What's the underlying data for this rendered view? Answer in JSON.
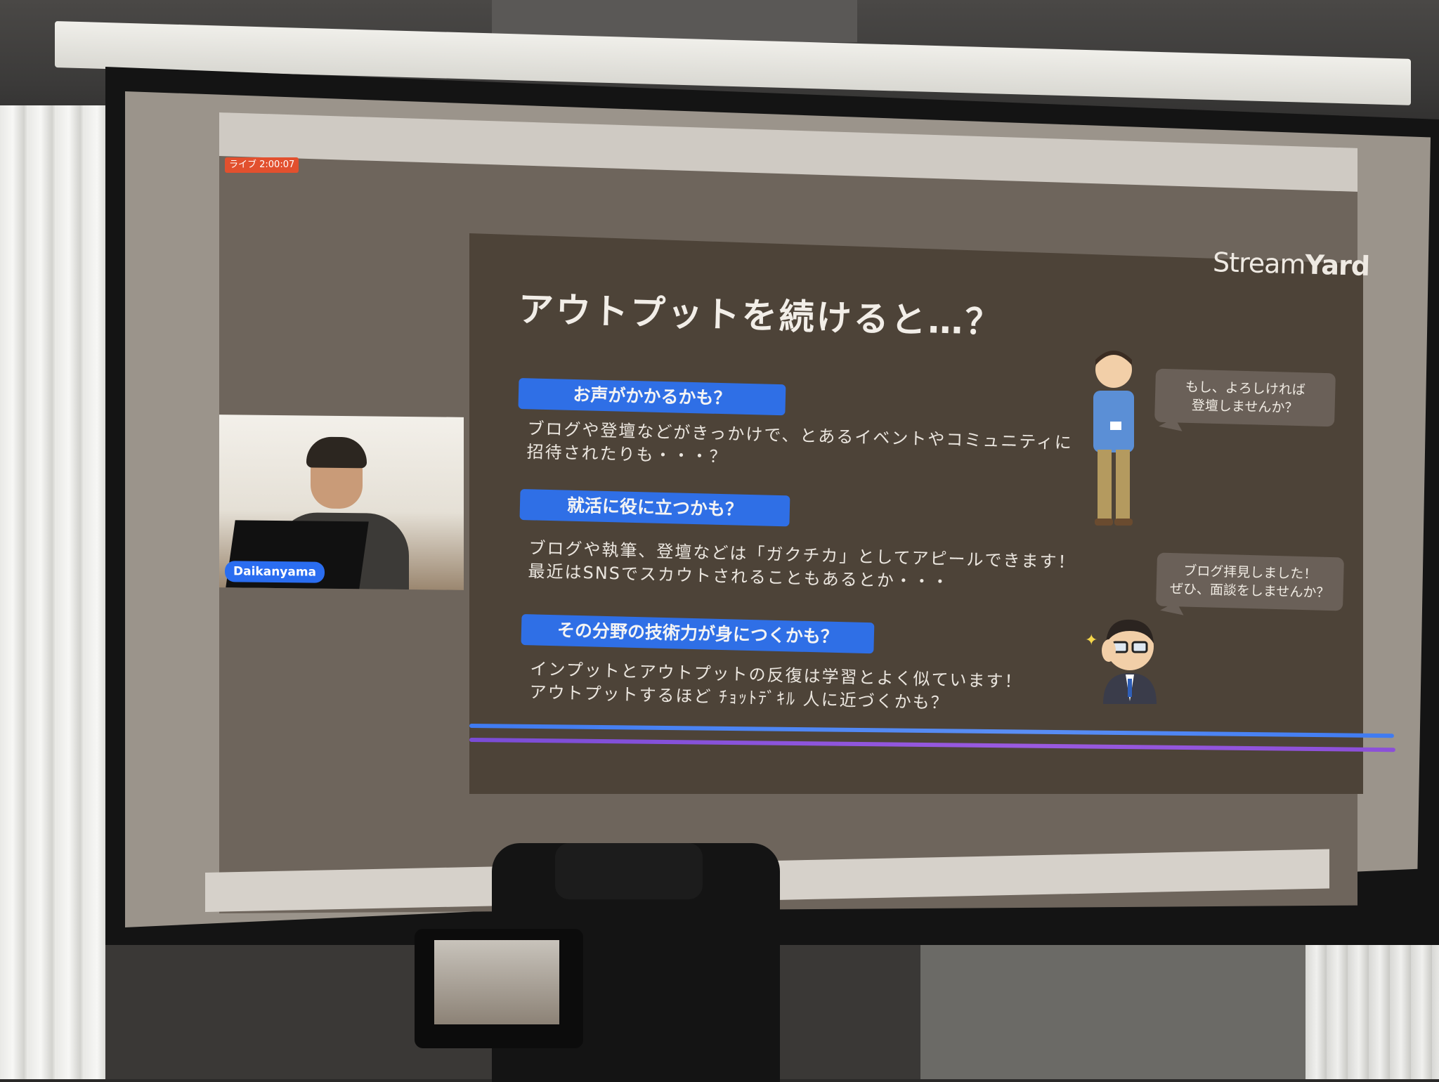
{
  "stream": {
    "live_badge": "ライブ 2:00:07",
    "speaker_name": "Daikanyama"
  },
  "slide": {
    "logo_light": "Stream",
    "logo_bold": "Yard",
    "title": "アウトプットを続けると…？",
    "sections": [
      {
        "heading": "お声がかかるかも？",
        "lines": [
          "ブログや登壇などがきっかけで、とあるイベントやコミュニティに",
          "招待されたりも・・・？"
        ]
      },
      {
        "heading": "就活に役に立つかも？",
        "lines": [
          "ブログや執筆、登壇などは「ガクチカ」としてアピールできます！",
          "最近はSNSでスカウトされることもあるとか・・・"
        ]
      },
      {
        "heading": "その分野の技術力が身につくかも？",
        "lines": [
          "インプットとアウトプットの反復は学習とよく似ています！",
          "アウトプットするほど ﾁｮｯﾄﾃﾞｷﾙ 人に近づくかも？"
        ]
      }
    ],
    "bubbles": [
      [
        "もし、よろしければ",
        "登壇しませんか？"
      ],
      [
        "ブログ拝見しました！",
        "ぜひ、面談をしませんか？"
      ]
    ]
  },
  "colors": {
    "slide_bg": "#4d4338",
    "pill_blue": "#2f6fe6",
    "live_red": "#e2502e",
    "stripe_blue": "#3f7bf2",
    "stripe_purple": "#8b4fd8"
  }
}
